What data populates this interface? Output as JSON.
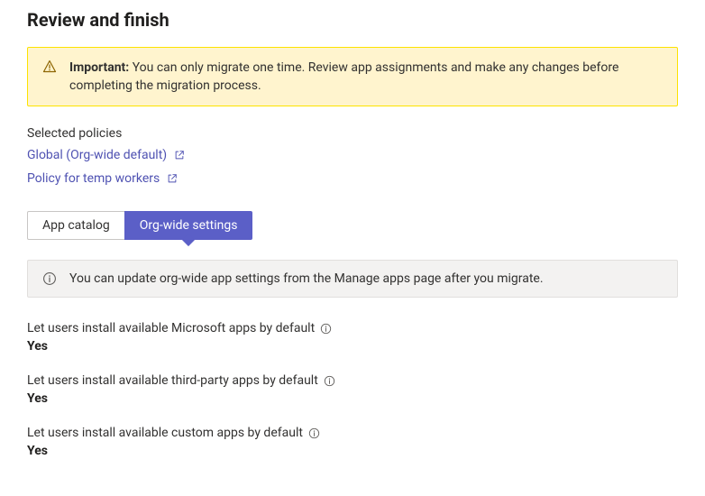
{
  "header": {
    "title": "Review and finish"
  },
  "alert": {
    "important_label": "Important:",
    "message": "You can only migrate one time. Review app assignments and make any changes before completing the migration process."
  },
  "selected_policies": {
    "label": "Selected policies",
    "items": [
      {
        "label": "Global (Org-wide default)"
      },
      {
        "label": "Policy for temp workers"
      }
    ]
  },
  "tabs": {
    "items": [
      {
        "label": "App catalog",
        "active": false
      },
      {
        "label": "Org-wide settings",
        "active": true
      }
    ]
  },
  "info_bar": {
    "message": "You can update org-wide app settings from the Manage apps page after you migrate."
  },
  "settings": [
    {
      "label": "Let users install available Microsoft apps by default",
      "value": "Yes"
    },
    {
      "label": "Let users install available third-party apps by default",
      "value": "Yes"
    },
    {
      "label": "Let users install available custom apps by default",
      "value": "Yes"
    }
  ],
  "colors": {
    "warning_bg": "#fff4ce",
    "warning_border": "#fde300",
    "link": "#4f52b2",
    "active_tab": "#5b5fc7",
    "info_bg": "#f3f2f1"
  }
}
